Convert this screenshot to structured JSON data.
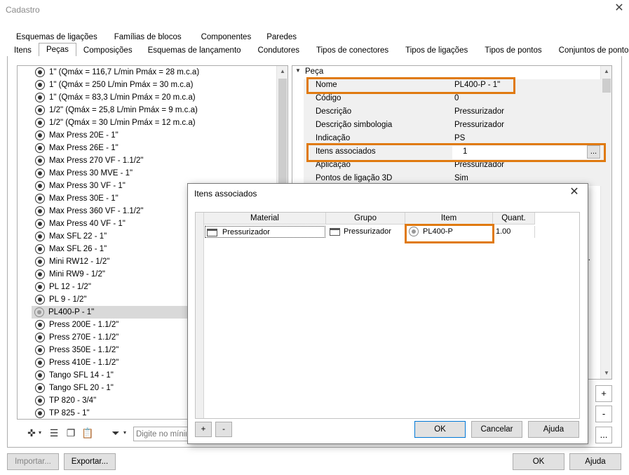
{
  "window": {
    "title": "Cadastro"
  },
  "tabs_row1": [
    "Esquemas de ligações",
    "Famílias de blocos",
    "Componentes",
    "Paredes"
  ],
  "tabs_row2": [
    "Itens",
    "Peças",
    "Composições",
    "Esquemas de lançamento",
    "Condutores",
    "Tipos de conectores",
    "Tipos de ligações",
    "Tipos de pontos",
    "Conjuntos de pontos"
  ],
  "active_tab": "Peças",
  "parts_list": [
    "1\" (Qmáx = 116,7 L/min Pmáx = 28 m.c.a)",
    "1\" (Qmáx = 250 L/min Pmáx = 30 m.c.a)",
    "1\" (Qmáx = 83,3 L/min Pmáx = 20 m.c.a)",
    "1/2\" (Qmáx = 25,8 L/min Pmáx = 9 m.c.a)",
    "1/2\" (Qmáx = 30 L/min Pmáx = 12 m.c.a)",
    "Max Press 20E - 1\"",
    "Max Press 26E - 1\"",
    "Max Press 270 VF - 1.1/2\"",
    "Max Press 30 MVE - 1\"",
    "Max Press 30 VF - 1\"",
    "Max Press 30E - 1\"",
    "Max Press 360 VF - 1.1/2\"",
    "Max Press 40 VF - 1\"",
    "Max SFL 22 - 1\"",
    "Max SFL 26 - 1\"",
    "Mini RW12 - 1/2\"",
    "Mini RW9 - 1/2\"",
    "PL 12 - 1/2\"",
    "PL 9 - 1/2\"",
    "PL400-P - 1\"",
    "Press 200E - 1.1/2\"",
    "Press 270E - 1.1/2\"",
    "Press 350E - 1.1/2\"",
    "Press 410E - 1.1/2\"",
    "Tango SFL 14 - 1\"",
    "Tango SFL 20 - 1\"",
    "TP 820 - 3/4\"",
    "TP 825 - 1\""
  ],
  "selected_part": "PL400-P - 1\"",
  "search": {
    "placeholder": "Digite no mínimo"
  },
  "properties": {
    "category": "Peça",
    "rows": [
      {
        "key": "Nome",
        "value": "PL400-P - 1\""
      },
      {
        "key": "Código",
        "value": "0"
      },
      {
        "key": "Descrição",
        "value": "Pressurizador"
      },
      {
        "key": "Descrição simbologia",
        "value": "Pressurizador"
      },
      {
        "key": "Indicação",
        "value": "PS"
      },
      {
        "key": "Itens associados",
        "value": "1"
      },
      {
        "key": "Aplicação",
        "value": "Pressurizador"
      },
      {
        "key": "Pontos de ligação 3D",
        "value": "Sim"
      }
    ],
    "ellipsis_label": "...",
    "truncated_label": "d..."
  },
  "side_buttons": {
    "add": "+",
    "remove": "-",
    "more": "..."
  },
  "bottom": {
    "import": "Importar...",
    "export": "Exportar...",
    "ok": "OK",
    "help": "Ajuda"
  },
  "dialog": {
    "title": "Itens associados",
    "columns": [
      "Material",
      "Grupo",
      "Item",
      "Quant."
    ],
    "rows": [
      {
        "material": "Pressurizador",
        "group": "Pressurizador",
        "item": "PL400-P",
        "qty": "1.00"
      }
    ],
    "add": "+",
    "remove": "-",
    "ok": "OK",
    "cancel": "Cancelar",
    "help": "Ajuda"
  },
  "colors": {
    "highlight": "#e07a10",
    "selection": "#d9d9d9",
    "focus": "#0078d7"
  }
}
